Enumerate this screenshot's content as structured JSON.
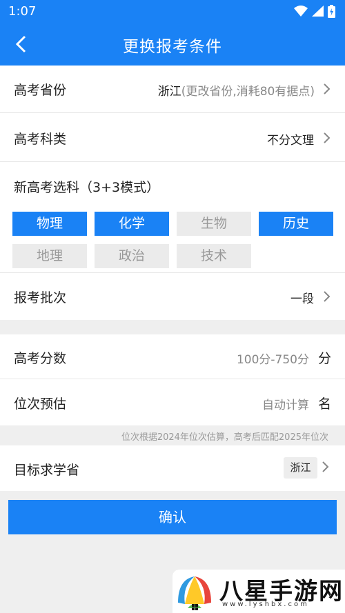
{
  "status": {
    "time": "1:07"
  },
  "header": {
    "title": "更换报考条件"
  },
  "province": {
    "label": "高考省份",
    "value": "浙江",
    "note": "(更改省份,消耗80有据点)"
  },
  "category": {
    "label": "高考科类",
    "value": "不分文理"
  },
  "subjects": {
    "label": "新高考选科（3+3模式）",
    "items": [
      {
        "label": "物理",
        "selected": true
      },
      {
        "label": "化学",
        "selected": true
      },
      {
        "label": "生物",
        "selected": false
      },
      {
        "label": "历史",
        "selected": true
      },
      {
        "label": "地理",
        "selected": false
      },
      {
        "label": "政治",
        "selected": false
      },
      {
        "label": "技术",
        "selected": false
      }
    ]
  },
  "batch": {
    "label": "报考批次",
    "value": "一段"
  },
  "score": {
    "label": "高考分数",
    "placeholder": "100分-750分",
    "unit": "分"
  },
  "rank": {
    "label": "位次预估",
    "placeholder": "自动计算",
    "unit": "名"
  },
  "rank_note": "位次根据2024年位次估算，高考后匹配2025年位次",
  "target": {
    "label": "目标求学省",
    "value": "浙江"
  },
  "confirm_label": "确认",
  "watermark": {
    "text": "八星手游网",
    "url": "www.lyshbx.com"
  },
  "colors": {
    "accent": "#1a82f5",
    "chip_off": "#ebebeb",
    "background": "#efefef"
  }
}
